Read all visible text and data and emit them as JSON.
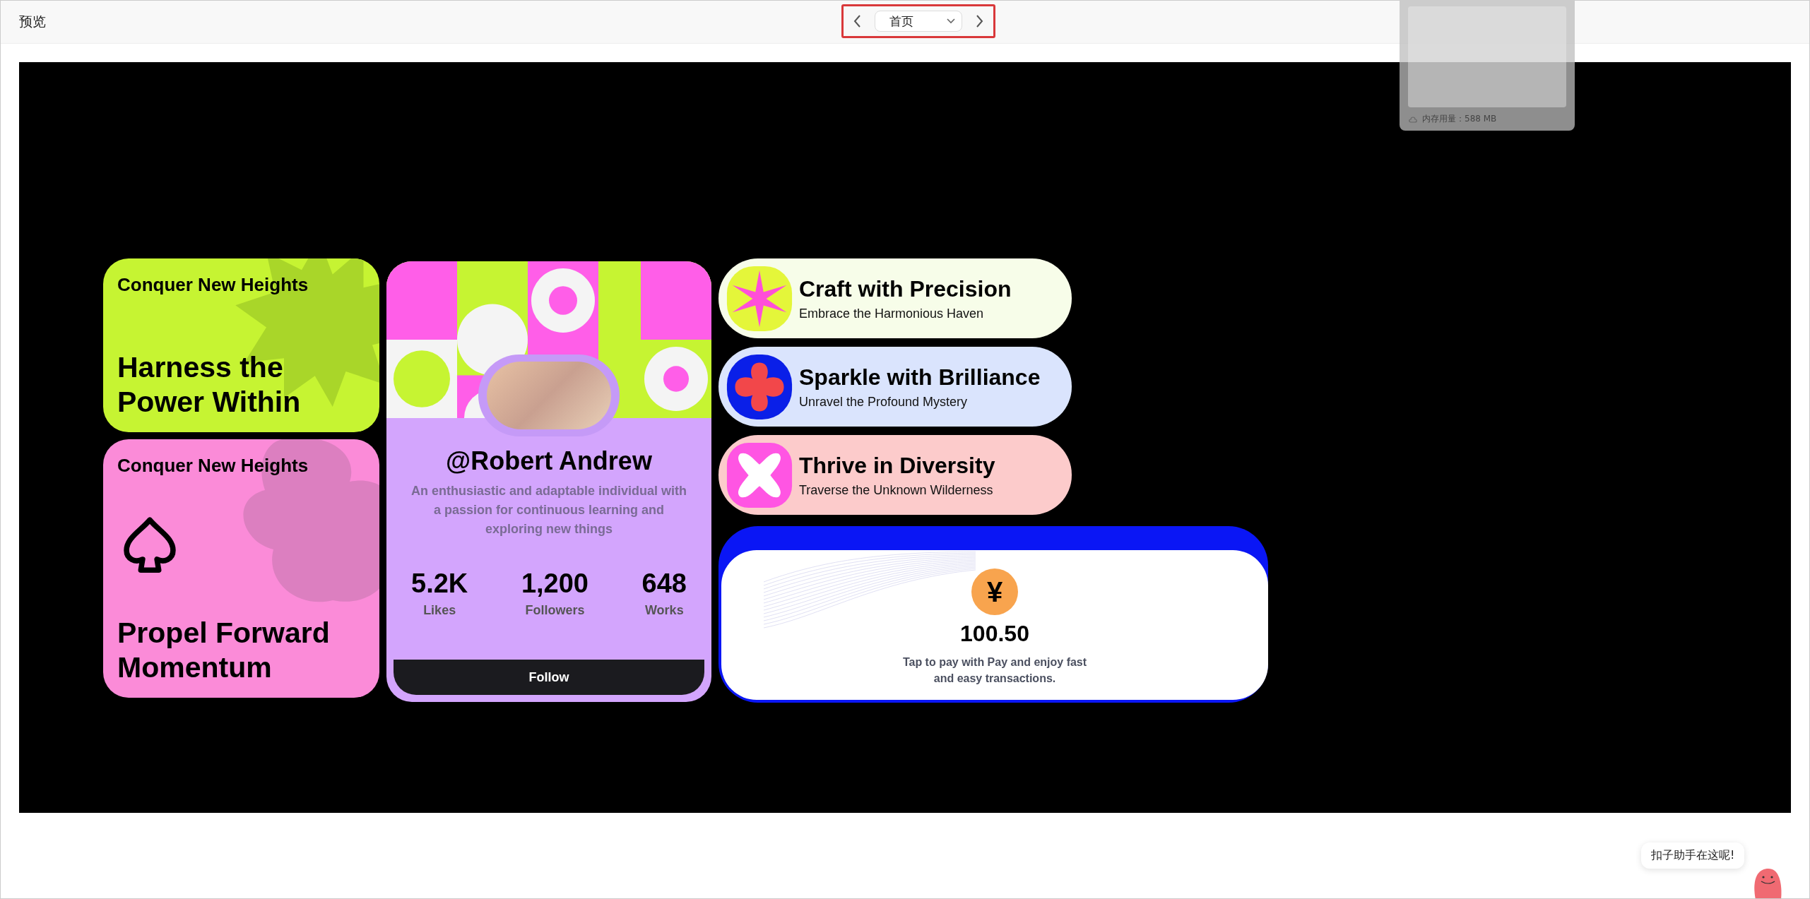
{
  "header": {
    "title": "预览",
    "page_select": {
      "value": "首页"
    }
  },
  "memory_panel": {
    "label": "内存用量：588 MB"
  },
  "feature_cards": [
    {
      "kind": "sun",
      "eyebrow": "Conquer New Heights",
      "headline": "Harness the Power Within",
      "color": "#c6f432"
    },
    {
      "kind": "spade",
      "eyebrow": "Conquer New Heights",
      "headline": "Propel Forward Momentum",
      "color": "#fb8bd8"
    }
  ],
  "profile": {
    "handle": "@Robert Andrew",
    "bio": "An enthusiastic and adaptable individual with a passion for continuous learning and exploring new things",
    "stats": [
      {
        "value": "5.2K",
        "label": "Likes"
      },
      {
        "value": "1,200",
        "label": "Followers"
      },
      {
        "value": "648",
        "label": "Works"
      }
    ],
    "button": "Follow"
  },
  "pills": [
    {
      "kind": "star",
      "title": "Craft with Precision",
      "subtitle": "Embrace the Harmonious Haven",
      "color": "#f7fde9"
    },
    {
      "kind": "flower",
      "title": "Sparkle with Brilliance",
      "subtitle": "Unravel the Profound Mystery",
      "color": "#dae4fd"
    },
    {
      "kind": "cross",
      "title": "Thrive in Diversity",
      "subtitle": "Traverse the Unknown Wilderness",
      "color": "#fccbcb"
    }
  ],
  "payment": {
    "symbol": "¥",
    "amount": "100.50",
    "description": "Tap to pay with Pay and enjoy fast and easy transactions."
  },
  "assistant": {
    "message": "扣子助手在这呢!"
  }
}
